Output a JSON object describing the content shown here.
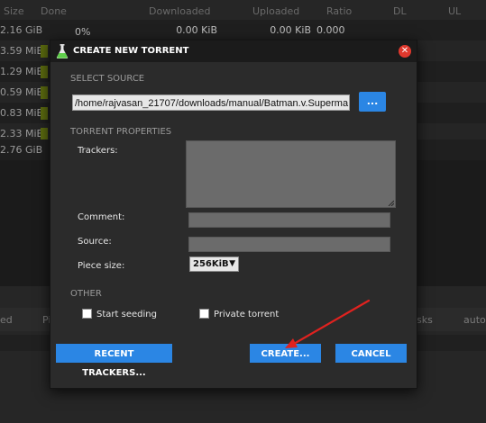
{
  "background_app": {
    "columns": [
      "Size",
      "Done",
      "Downloaded",
      "Uploaded",
      "Ratio",
      "DL",
      "UL"
    ],
    "first_row": {
      "done": "0%",
      "downloaded": "0.00 KiB",
      "uploaded": "0.00 KiB",
      "ratio": "0.000"
    },
    "sizes": [
      "2.16 GiB",
      "3.59 MiB",
      "1.29 MiB",
      "0.59 MiB",
      "0.83 MiB",
      "2.33 MiB",
      "2.76 GiB"
    ],
    "lower_tabs": [
      "ed",
      "Pi",
      "sks",
      "autoc"
    ]
  },
  "dialog": {
    "title": "CREATE NEW TORRENT",
    "select_source_heading": "SELECT SOURCE",
    "source_path": "/home/rajvasan_21707/downloads/manual/Batman.v.Superma",
    "browse_label": "...",
    "torrent_properties_heading": "TORRENT PROPERTIES",
    "trackers_label": "Trackers:",
    "comment_label": "Comment:",
    "source_label": "Source:",
    "piece_size_label": "Piece size:",
    "piece_size_value": "256KiB",
    "other_heading": "OTHER",
    "start_seeding_label": "Start seeding",
    "private_torrent_label": "Private torrent",
    "recent_trackers_button": "RECENT TRACKERS...",
    "create_button": "CREATE...",
    "cancel_button": "CANCEL"
  },
  "colors": {
    "accent": "#2b86e4",
    "close": "#e0382d",
    "annotation_arrow": "#e0221f"
  },
  "icons": [
    "flask-icon",
    "close-icon",
    "dropdown-arrow-icon",
    "resize-grip-icon",
    "annotation-arrow"
  ]
}
